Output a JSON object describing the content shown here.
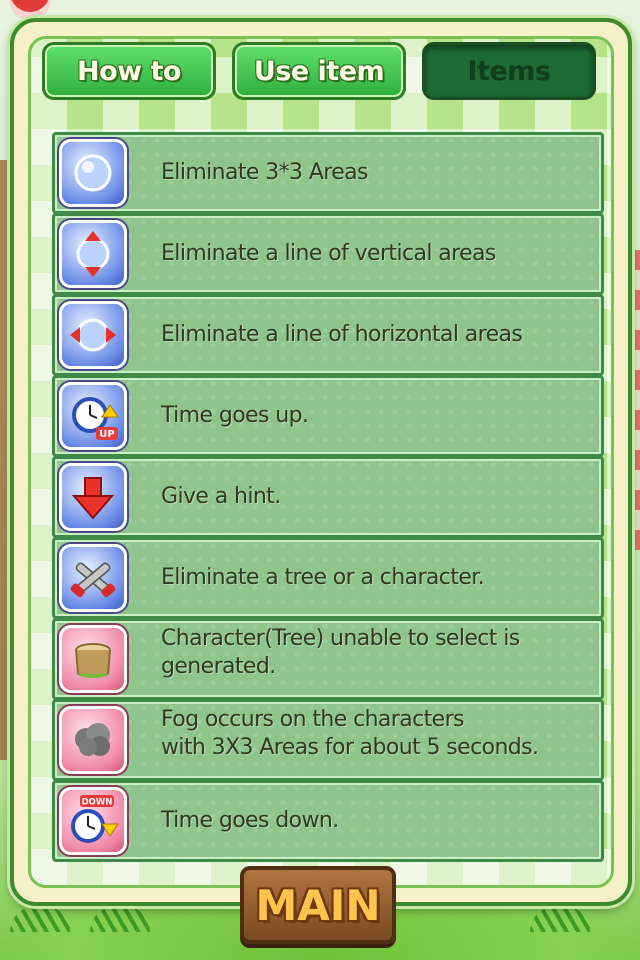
{
  "tabs": {
    "how_to": "How to",
    "use_item": "Use item",
    "items": "Items"
  },
  "selected_tab": "items",
  "items": [
    {
      "icon": "bomb-orb-icon",
      "lines": [
        "Eliminate 3*3 Areas"
      ]
    },
    {
      "icon": "vertical-arrows-orb-icon",
      "lines": [
        "Eliminate a line of vertical areas"
      ]
    },
    {
      "icon": "horizontal-arrows-orb-icon",
      "lines": [
        "Eliminate a line of horizontal areas"
      ]
    },
    {
      "icon": "clock-up-icon",
      "lines": [
        "Time goes up."
      ]
    },
    {
      "icon": "red-down-arrow-icon",
      "lines": [
        "Give a hint."
      ]
    },
    {
      "icon": "crossed-saws-icon",
      "lines": [
        "Eliminate a tree or a character."
      ]
    },
    {
      "icon": "tree-stump-icon",
      "lines": [
        "Character(Tree) unable to select is",
        "generated."
      ]
    },
    {
      "icon": "fog-cloud-icon",
      "lines": [
        "Fog occurs on the characters",
        "with 3X3 Areas for about 5 seconds."
      ]
    },
    {
      "icon": "clock-down-icon",
      "lines": [
        "Time goes down."
      ]
    }
  ],
  "icon_badges": {
    "up": "UP",
    "down": "DOWN"
  },
  "main_button": "MAIN",
  "colors": {
    "tab_active": "#1d6a34",
    "tab_normal": "#3cc24f",
    "row_bg": "#8fc48d",
    "main_text": "#ffc44d"
  }
}
